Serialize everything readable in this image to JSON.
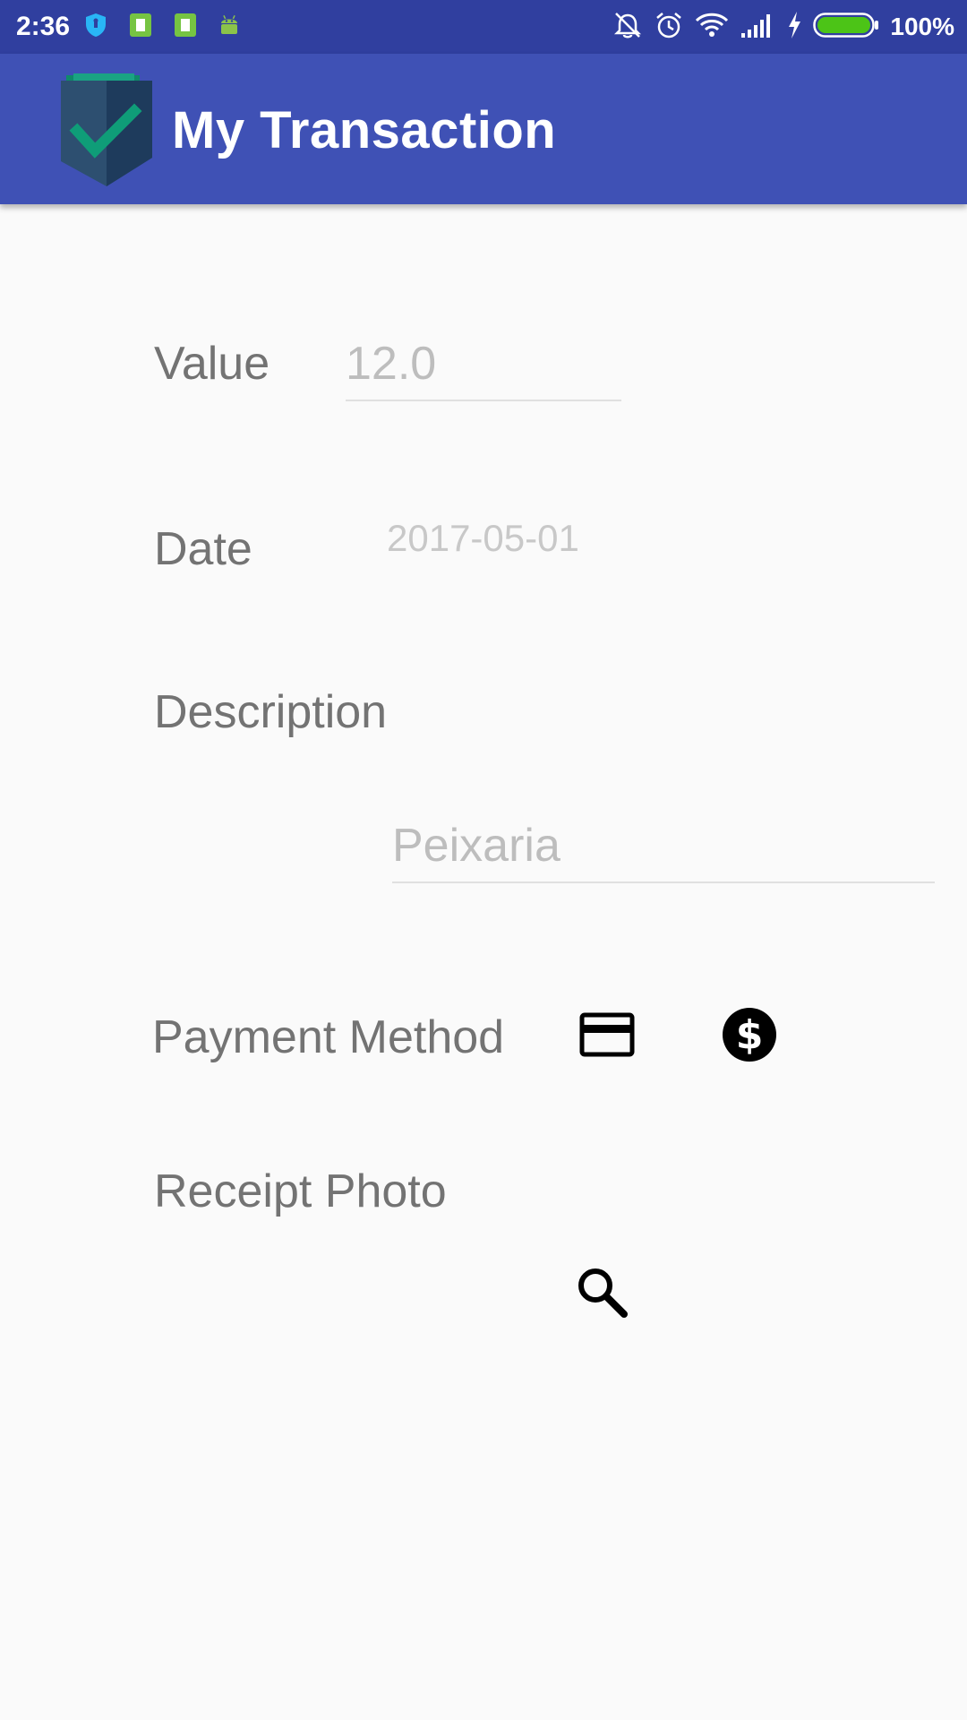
{
  "status_bar": {
    "time": "2:36",
    "battery_percent": "100%",
    "battery_level": 1.0,
    "notification_icons": [
      "shield-icon",
      "sim-card-icon",
      "sim-card-icon",
      "android-icon"
    ],
    "system_icons": [
      "alarm-off-icon",
      "alarm-clock-icon",
      "wifi-icon",
      "signal-icon",
      "charging-icon",
      "battery-icon"
    ],
    "colors": {
      "background": "#303f9f",
      "battery_fill": "#4cc417"
    }
  },
  "app_bar": {
    "title": "My Transaction",
    "logo_icon": "shield-check-icon",
    "colors": {
      "background": "#3f51b5",
      "logo_check": "#0f9d78"
    }
  },
  "form": {
    "value": {
      "label": "Value",
      "hint": "12.0"
    },
    "date": {
      "label": "Date",
      "value": "2017-05-01"
    },
    "description": {
      "label": "Description",
      "hint": "Peixaria"
    },
    "payment_method": {
      "label": "Payment Method",
      "options": [
        "credit-card-icon",
        "dollar-icon"
      ]
    },
    "receipt_photo": {
      "label": "Receipt Photo",
      "action_icon": "search-icon"
    }
  }
}
